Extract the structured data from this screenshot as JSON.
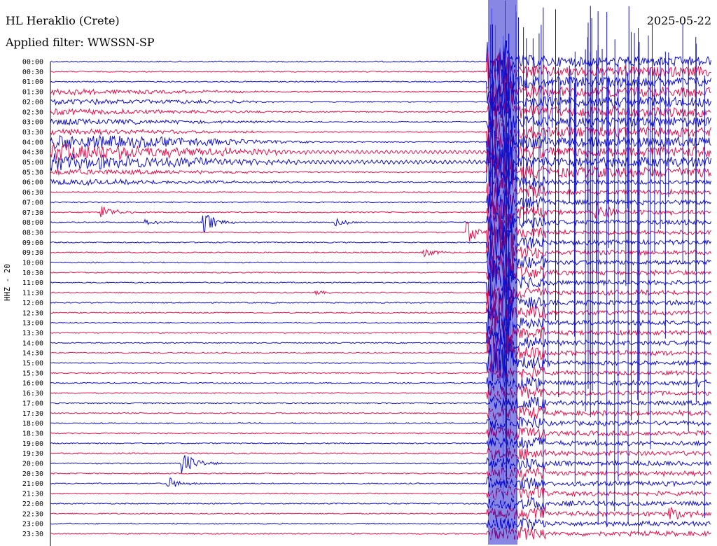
{
  "header": {
    "station": "HL Heraklio (Crete)",
    "filter": "Applied filter: WWSSN-SP",
    "date": "2025-05-22"
  },
  "chart_data": {
    "type": "line",
    "title": "HL Heraklio (Crete)",
    "subtitle": "Applied filter: WWSSN-SP",
    "date": "2025-05-22",
    "ylabel": "HHZ - 20",
    "row_labels": [
      "00:00",
      "00:30",
      "01:00",
      "01:30",
      "02:00",
      "02:30",
      "03:00",
      "03:30",
      "04:00",
      "04:30",
      "05:00",
      "05:30",
      "06:00",
      "06:30",
      "07:00",
      "07:30",
      "08:00",
      "08:30",
      "09:00",
      "09:30",
      "10:00",
      "10:30",
      "11:00",
      "11:30",
      "12:00",
      "12:30",
      "13:00",
      "13:30",
      "14:00",
      "14:30",
      "15:00",
      "15:30",
      "16:00",
      "16:30",
      "17:00",
      "17:30",
      "18:00",
      "18:30",
      "19:00",
      "19:30",
      "20:00",
      "20:30",
      "21:00",
      "21:30",
      "22:00",
      "22:30",
      "23:00",
      "23:30"
    ],
    "row_colors": [
      "#1010c8",
      "#e8104a"
    ],
    "series": [
      {
        "kind": "event",
        "row": 15,
        "t": 0.12,
        "amp": 10
      },
      {
        "kind": "event",
        "row": 16,
        "t": 0.35,
        "amp": 14
      },
      {
        "kind": "event",
        "row": 16,
        "t": 0.22,
        "amp": 4
      },
      {
        "kind": "event",
        "row": 16,
        "t": 0.65,
        "amp": 5
      },
      {
        "kind": "event",
        "row": 17,
        "t": 0.95,
        "amp": 14
      },
      {
        "kind": "event",
        "row": 15,
        "t": 1.24,
        "amp": 14
      },
      {
        "kind": "event",
        "row": 19,
        "t": 0.85,
        "amp": 6
      },
      {
        "kind": "event",
        "row": 40,
        "t": 0.3,
        "amp": 18
      },
      {
        "kind": "event",
        "row": 42,
        "t": 0.27,
        "amp": 8
      },
      {
        "kind": "event",
        "row": 45,
        "t": 1.41,
        "amp": 12
      },
      {
        "kind": "event",
        "row": 32,
        "t": 1.47,
        "amp": 8
      },
      {
        "kind": "event",
        "row": 23,
        "t": 0.6,
        "amp": 3
      }
    ]
  }
}
